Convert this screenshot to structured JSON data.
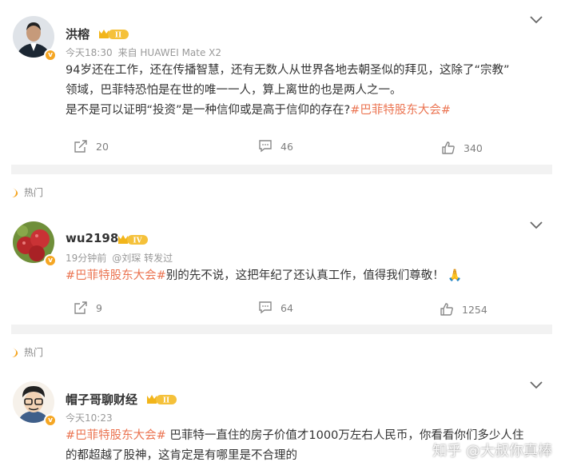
{
  "posts": [
    {
      "username": "洪榕",
      "level": "II",
      "meta_time": "今天18:30",
      "meta_source": "来自 HUAWEI Mate X2",
      "text_line1": "94岁还在工作，还在传播智慧，还有无数人从世界各地去朝圣似的拜见，这除了“宗教”",
      "text_line2": "领域，巴菲特恐怕是在世的唯一一人，算上离世的也是两人之一。",
      "text_line3_plain": "是不是可以证明“投资”是一种信仰或是高于信仰的存在?",
      "text_line3_tag": "#巴菲特股东大会#",
      "reposts": "20",
      "comments": "46",
      "likes": "340"
    },
    {
      "username": "wu2198",
      "level": "IV",
      "meta_time": "19分钟前",
      "meta_source": "@刘琛 转发过",
      "text_tag": "#巴菲特股东大会#",
      "text_plain": "别的先不说，这把年纪了还认真工作，值得我们尊敬！",
      "emoji": "🙏",
      "reposts": "9",
      "comments": "64",
      "likes": "1254"
    },
    {
      "username": "帽子哥聊财经",
      "level": "II",
      "meta_time": "今天10:23",
      "text_tag": "#巴菲特股东大会#",
      "text_plain1": " 巴菲特一直住的房子价值才1000万左右人民币，你看看你们多少人住",
      "text_line2": "的都超越了股神，这肯定是有哪里是不合理的"
    }
  ],
  "hot_label": "热门",
  "watermark": "知乎 @大叔你真棒",
  "colors": {
    "tag": "#eb7350",
    "badge": "#f5a623",
    "divider": "#f2f2f2"
  },
  "icons": [
    "chevron-down-icon",
    "repost-icon",
    "comment-icon",
    "like-icon",
    "hot-flame-icon",
    "verified-badge-icon",
    "level-badge-icon"
  ]
}
